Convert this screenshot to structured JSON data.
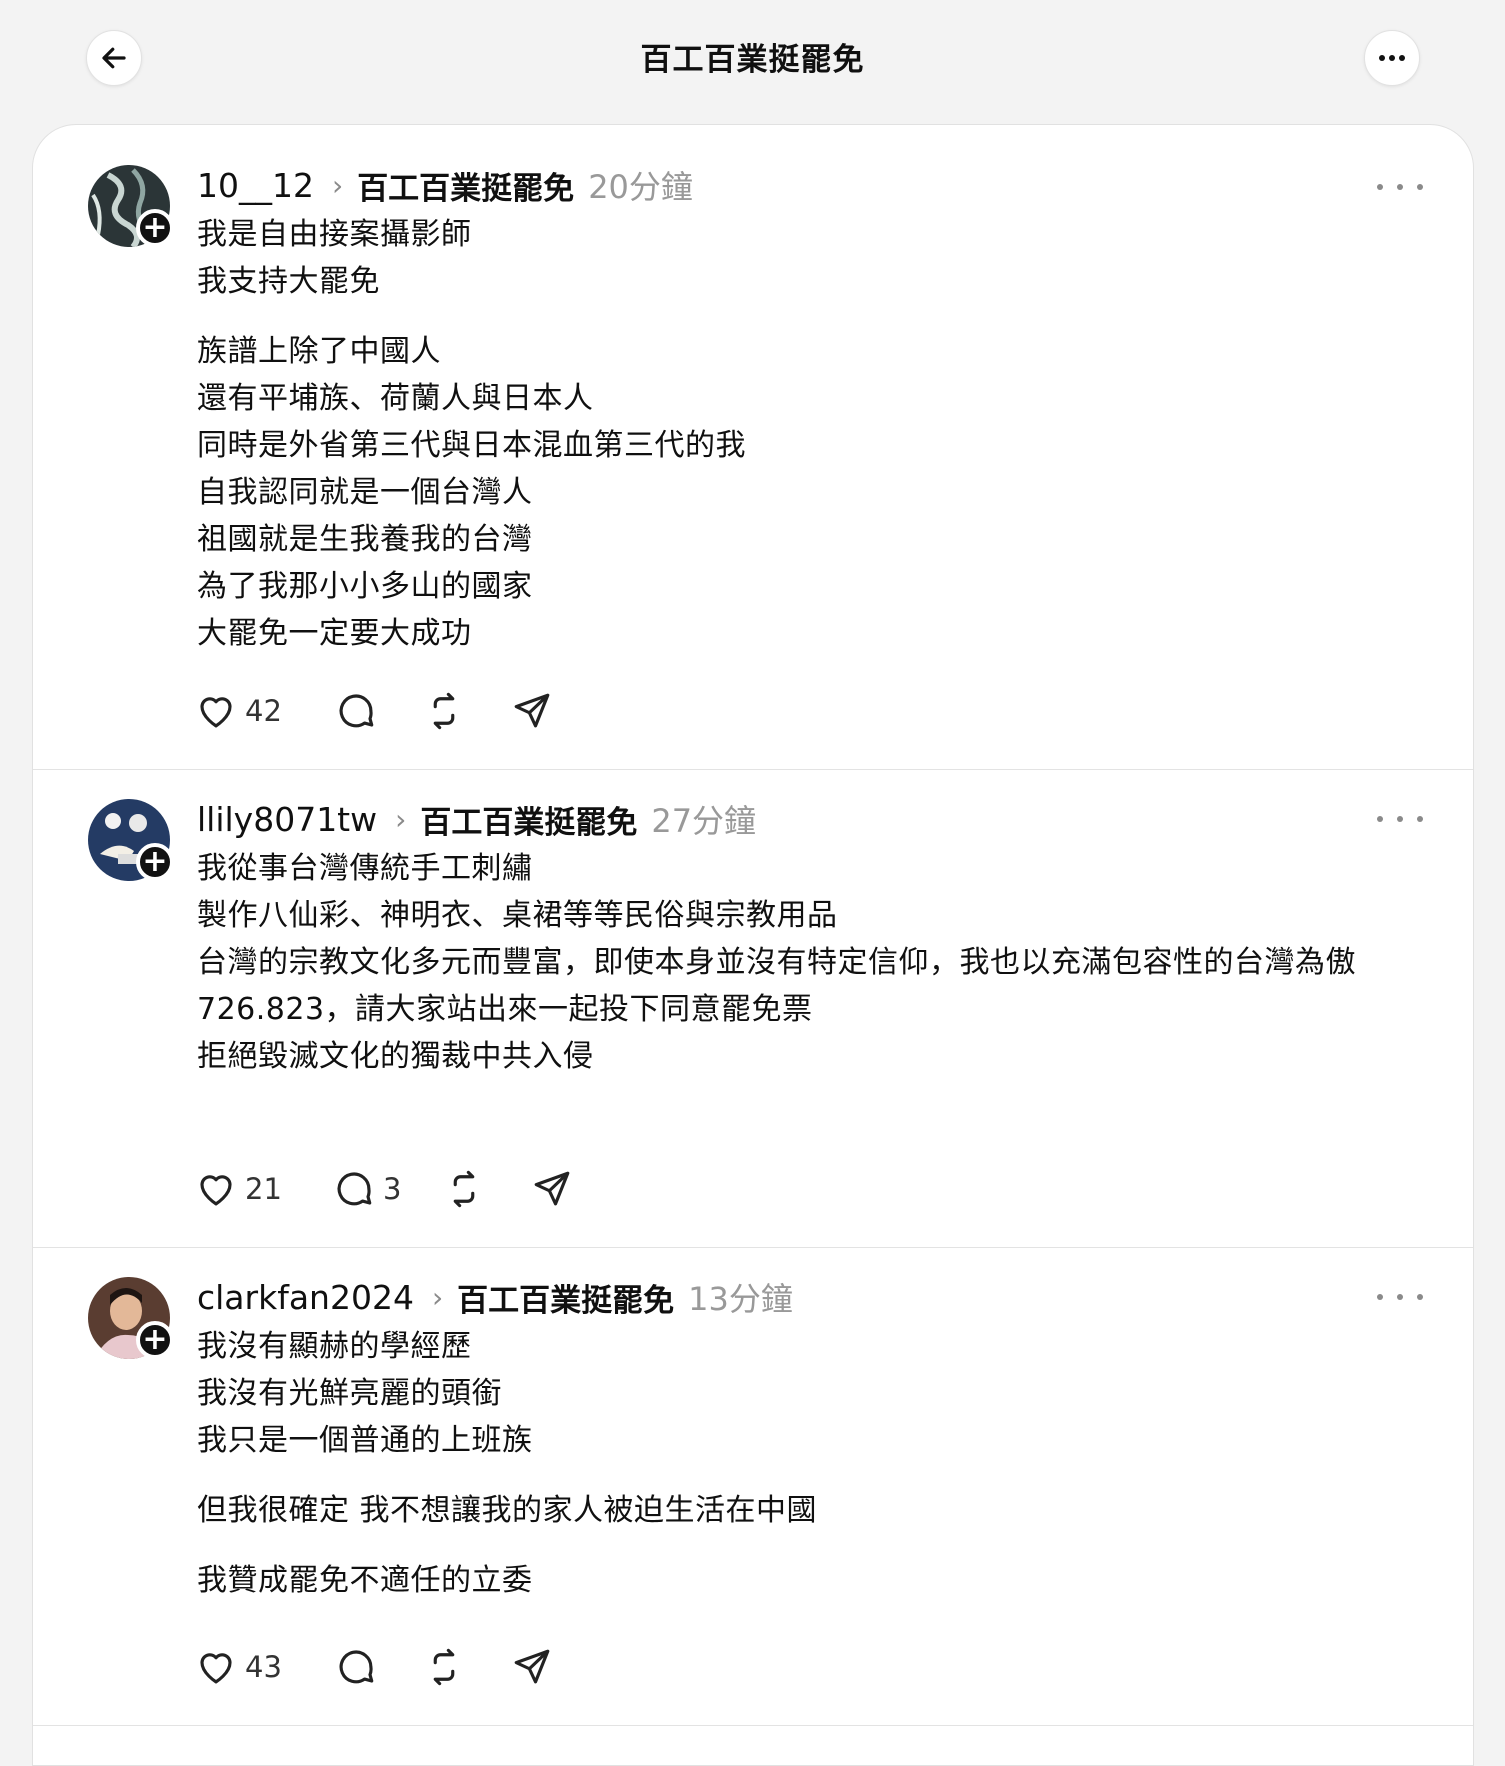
{
  "header": {
    "title": "百工百業挺罷免"
  },
  "posts": [
    {
      "username": "10__12",
      "community": "百工百業挺罷免",
      "time": "20分鐘",
      "lines": [
        "我是自由接案攝影師",
        "我支持大罷免",
        "",
        "族譜上除了中國人",
        "還有平埔族、荷蘭人與日本人",
        "同時是外省第三代與日本混血第三代的我",
        "自我認同就是一個台灣人",
        "祖國就是生我養我的台灣",
        "為了我那小小多山的國家",
        "大罷免一定要大成功"
      ],
      "likes": "42",
      "comments": "",
      "avatar_color": "#2d3a3c"
    },
    {
      "username": "llily8071tw",
      "community": "百工百業挺罷免",
      "time": "27分鐘",
      "lines": [
        "我從事台灣傳統手工刺繡",
        "製作八仙彩、神明衣、桌裙等等民俗與宗教用品",
        "台灣的宗教文化多元而豐富，即使本身並沒有特定信仰，我也以充滿包容性的台灣為傲",
        "726.823，請大家站出來一起投下同意罷免票",
        "拒絕毀滅文化的獨裁中共入侵"
      ],
      "likes": "21",
      "comments": "3",
      "avatar_color": "#233a63"
    },
    {
      "username": "clarkfan2024",
      "community": "百工百業挺罷免",
      "time": "13分鐘",
      "lines": [
        "我沒有顯赫的學經歷",
        "我沒有光鮮亮麗的頭銜",
        "我只是一個普通的上班族",
        "",
        "但我很確定 我不想讓我的家人被迫生活在中國",
        "",
        "我贊成罷免不適任的立委"
      ],
      "likes": "43",
      "comments": "",
      "avatar_color": "#7a5a48"
    }
  ]
}
